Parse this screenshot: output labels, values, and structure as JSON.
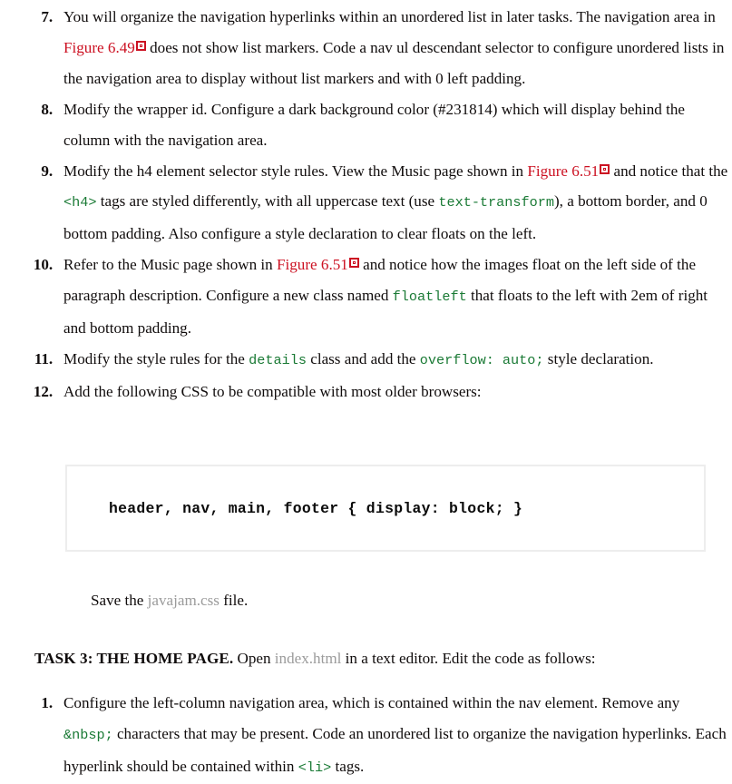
{
  "document": {
    "type": "textbook-exercise-page",
    "colors": {
      "figure_reference": "#CC1122",
      "inline_code": "#1A7A35",
      "filename": "#9B9B9B",
      "code_box_border": "#EDEDED",
      "body_text": "#100C0C"
    }
  },
  "upper_list": {
    "items": [
      {
        "number": "7.",
        "segments": [
          {
            "type": "text",
            "value": "You will organize the navigation hyperlinks within an unordered list in later tasks. The navigation area in "
          },
          {
            "type": "figref",
            "value": "Figure 6.49"
          },
          {
            "type": "figicon",
            "value": "figure-link-icon"
          },
          {
            "type": "text",
            "value": " does not show list markers. Code a nav ul descendant selector to configure unordered lists in the navigation area to display without list markers and with 0 left padding."
          }
        ]
      },
      {
        "number": "8.",
        "segments": [
          {
            "type": "text",
            "value": "Modify the wrapper id. Configure a dark background color (#231814) which will display behind the column with the navigation area."
          }
        ]
      },
      {
        "number": "9.",
        "segments": [
          {
            "type": "text",
            "value": "Modify the h4 element selector style rules. View the Music page shown in "
          },
          {
            "type": "figref",
            "value": "Figure 6.51"
          },
          {
            "type": "figicon",
            "value": "figure-link-icon"
          },
          {
            "type": "text",
            "value": " and notice that the "
          },
          {
            "type": "code",
            "value": "<h4>"
          },
          {
            "type": "text",
            "value": " tags are styled differently, with all uppercase text (use "
          },
          {
            "type": "code",
            "value": "text-transform"
          },
          {
            "type": "text",
            "value": "), a bottom border, and 0 bottom padding. Also configure a style declaration to clear floats on the left."
          }
        ]
      },
      {
        "number": "10.",
        "segments": [
          {
            "type": "text",
            "value": "Refer to the Music page shown in "
          },
          {
            "type": "figref",
            "value": "Figure 6.51"
          },
          {
            "type": "figicon",
            "value": "figure-link-icon"
          },
          {
            "type": "text",
            "value": " and notice how the images float on the left side of the paragraph description. Configure a new class named "
          },
          {
            "type": "code",
            "value": "floatleft"
          },
          {
            "type": "text",
            "value": " that floats to the left with 2em of right and bottom padding."
          }
        ]
      },
      {
        "number": "11.",
        "segments": [
          {
            "type": "text",
            "value": "Modify the style rules for the "
          },
          {
            "type": "code",
            "value": "details"
          },
          {
            "type": "text",
            "value": " class and add the "
          },
          {
            "type": "code",
            "value": "overflow: auto;"
          },
          {
            "type": "text",
            "value": " style declaration."
          }
        ]
      },
      {
        "number": "12.",
        "segments": [
          {
            "type": "text",
            "value": "Add the following CSS to be compatible with most older browsers:"
          }
        ]
      }
    ]
  },
  "code_box": {
    "line": "header, nav, main, footer { display: block; }"
  },
  "save_line": {
    "segments": [
      {
        "type": "text",
        "value": "Save the "
      },
      {
        "type": "filename",
        "value": "javajam.css"
      },
      {
        "type": "text",
        "value": " file."
      }
    ]
  },
  "task_heading": {
    "segments": [
      {
        "type": "bold",
        "value": "TASK 3: THE HOME PAGE."
      },
      {
        "type": "text",
        "value": "  Open "
      },
      {
        "type": "filename",
        "value": "index.html"
      },
      {
        "type": "text",
        "value": " in a text editor. Edit the code as follows:"
      }
    ]
  },
  "lower_list": {
    "items": [
      {
        "number": "1.",
        "segments": [
          {
            "type": "text",
            "value": "Configure the left-column navigation area, which is contained within the nav element. Remove any "
          },
          {
            "type": "code",
            "value": "&nbsp;"
          },
          {
            "type": "text",
            "value": " characters that may be present. Code an unordered list to organize the navigation hyperlinks. Each hyperlink should be contained within "
          },
          {
            "type": "code",
            "value": "<li>"
          },
          {
            "type": "text",
            "value": " tags."
          }
        ]
      }
    ]
  }
}
